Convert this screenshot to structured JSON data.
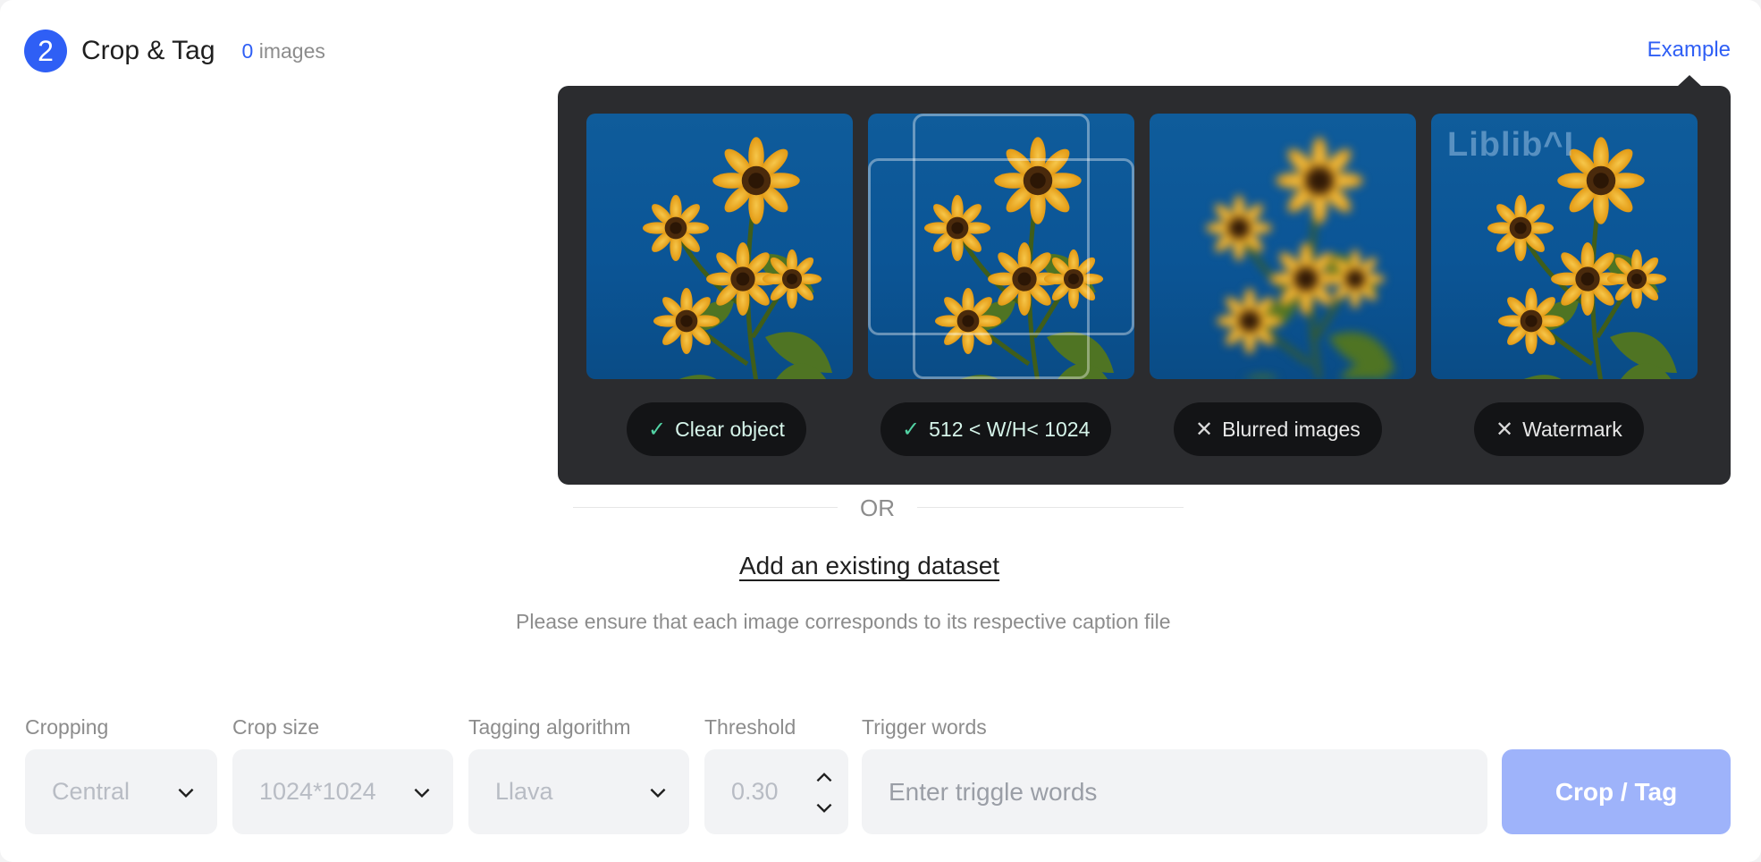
{
  "header": {
    "step_number": "2",
    "title": "Crop & Tag",
    "count_value": "0",
    "count_suffix": "images",
    "example_link": "Example"
  },
  "examples": [
    {
      "label": "Clear object",
      "status": "ok",
      "mark": "✓"
    },
    {
      "label": "512 < W/H< 1024",
      "status": "ok",
      "mark": "✓"
    },
    {
      "label": "Blurred images",
      "status": "bad",
      "mark": "✕"
    },
    {
      "label": "Watermark",
      "status": "bad",
      "mark": "✕",
      "watermark_text": "Liblib^I"
    }
  ],
  "divider_text": "OR",
  "dataset": {
    "link_label": "Add an existing dataset",
    "hint": "Please ensure that each image corresponds to its respective caption file"
  },
  "controls": {
    "cropping": {
      "label": "Cropping",
      "value": "Central"
    },
    "crop_size": {
      "label": "Crop size",
      "value": "1024*1024"
    },
    "tagging": {
      "label": "Tagging algorithm",
      "value": "Llava"
    },
    "threshold": {
      "label": "Threshold",
      "value": "0.30"
    },
    "trigger": {
      "label": "Trigger words",
      "value": "",
      "placeholder": "Enter triggle words"
    },
    "submit_label": "Crop / Tag"
  },
  "colors": {
    "accent": "#2f5ff5",
    "primary_disabled": "#9eb3fa",
    "popover_bg": "#2b2c2f",
    "ok_mark": "#52d3a4"
  },
  "icons": [
    "check-icon",
    "close-icon",
    "chevron-down-icon",
    "chevron-up-icon"
  ]
}
